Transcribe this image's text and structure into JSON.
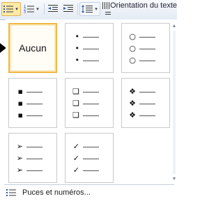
{
  "ribbon": {
    "label": "Orientation du texte",
    "buttons": [
      {
        "name": "bullets-button",
        "icon": "bullet-list-icon",
        "state": "active"
      },
      {
        "name": "numbering-button",
        "icon": "numbered-list-icon",
        "state": "normal"
      },
      {
        "name": "decrease-indent-button",
        "icon": "decrease-indent-icon",
        "state": "normal"
      },
      {
        "name": "increase-indent-button",
        "icon": "increase-indent-icon",
        "state": "normal"
      },
      {
        "name": "line-spacing-button",
        "icon": "line-spacing-icon",
        "state": "hover"
      }
    ],
    "accent_color": "#ffe9a8"
  },
  "gallery": {
    "items": [
      {
        "id": "none",
        "label": "Aucun",
        "selected": true
      },
      {
        "id": "small-dot",
        "glyph": "•"
      },
      {
        "id": "hollow-circle",
        "glyph": "○"
      },
      {
        "id": "filled-square",
        "glyph": "▪"
      },
      {
        "id": "hollow-square",
        "glyph": "❑"
      },
      {
        "id": "diamond-four",
        "glyph": "❖"
      },
      {
        "id": "arrowhead",
        "glyph": "➢"
      },
      {
        "id": "checkmark",
        "glyph": "✓"
      }
    ],
    "selection_color": "#f0b84a"
  },
  "footer": {
    "label": "Puces et numéros...",
    "icon": "bullet-list-icon"
  }
}
